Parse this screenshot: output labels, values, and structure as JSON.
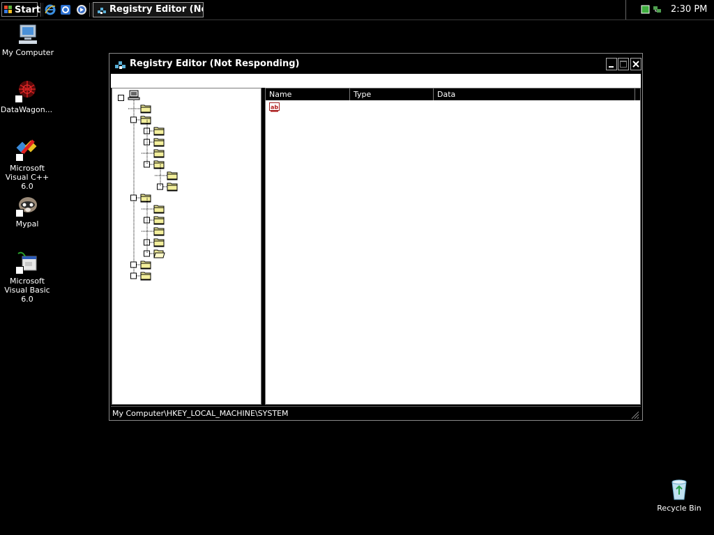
{
  "taskbar": {
    "start_label": "Start",
    "quick_launch": [
      "internet-explorer-icon",
      "outlook-express-icon",
      "media-player-icon"
    ],
    "task_button_label": "Registry Editor (No...",
    "clock": "2:30 PM"
  },
  "desktop": {
    "icons": [
      {
        "label": "My Computer",
        "icon": "my-computer-icon"
      },
      {
        "label": "DataWagon...",
        "icon": "datawagon-icon"
      },
      {
        "label": "Microsoft Visual C++ 6.0",
        "icon": "visual-cpp-icon"
      },
      {
        "label": "Mypal",
        "icon": "mypal-icon"
      },
      {
        "label": "Microsoft Visual Basic 6.0",
        "icon": "visual-basic-icon"
      },
      {
        "label": "Recycle Bin",
        "icon": "recycle-bin-icon"
      }
    ]
  },
  "window": {
    "title": "Registry Editor (Not Responding)",
    "list_columns": [
      "Name",
      "Type",
      "Data"
    ],
    "status_path": "My Computer\\HKEY_LOCAL_MACHINE\\SYSTEM"
  },
  "colors": {
    "background": "#000000",
    "pane": "#ffffff",
    "folder": "#f3ef9c"
  }
}
